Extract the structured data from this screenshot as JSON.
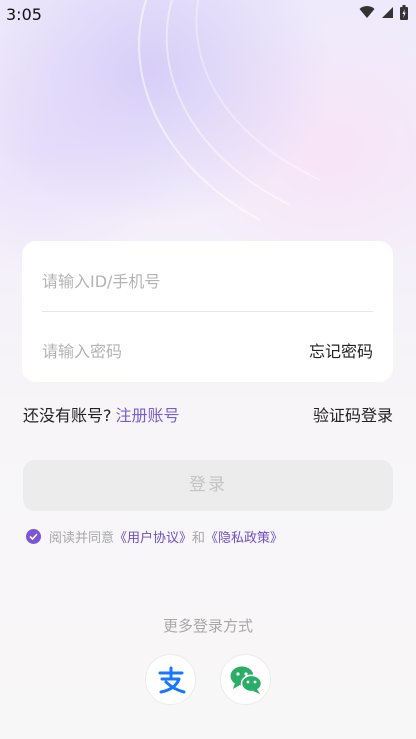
{
  "status": {
    "time": "3:05"
  },
  "form": {
    "id_placeholder": "请输入ID/手机号",
    "password_placeholder": "请输入密码",
    "forgot_password": "忘记密码"
  },
  "register": {
    "prompt": "还没有账号?",
    "link": "注册账号",
    "code_login": "验证码登录"
  },
  "login_button": "登录",
  "agreement": {
    "checked": true,
    "prefix": "阅读并同意",
    "user_agreement": "《用户协议》",
    "and": "和",
    "privacy_policy": "《隐私政策》"
  },
  "more_login": {
    "title": "更多登录方式",
    "options": [
      "alipay-icon",
      "wechat-icon"
    ]
  },
  "colors": {
    "accent": "#7a5fd3",
    "alipay": "#1677ff",
    "wechat": "#2aae67"
  }
}
